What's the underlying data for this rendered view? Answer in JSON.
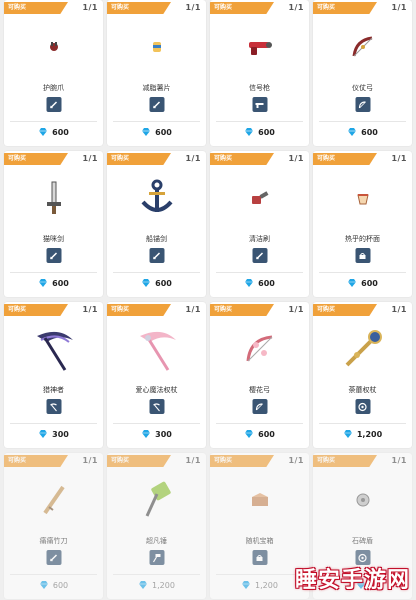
{
  "ribbon_label": "可购买",
  "colors": {
    "ribbon": "#f0a13a",
    "gem": "#1fa6e6",
    "type_icon_bg": "#3a5573"
  },
  "items": [
    {
      "name": "护腕爪",
      "count": "1/1",
      "price": "600",
      "type_icon": "sword-icon",
      "art": "claw-icon",
      "faded": false
    },
    {
      "name": "减脂薯片",
      "count": "1/1",
      "price": "600",
      "type_icon": "sword-icon",
      "art": "chips-icon",
      "faded": false
    },
    {
      "name": "信号枪",
      "count": "1/1",
      "price": "600",
      "type_icon": "gun-icon",
      "art": "flare-gun-icon",
      "faded": false
    },
    {
      "name": "仪仗弓",
      "count": "1/1",
      "price": "600",
      "type_icon": "bow-icon",
      "art": "bow-icon",
      "faded": false
    },
    {
      "name": "猫咪剑",
      "count": "1/1",
      "price": "600",
      "type_icon": "sword-icon",
      "art": "cat-sword-icon",
      "faded": false
    },
    {
      "name": "船锚剑",
      "count": "1/1",
      "price": "600",
      "type_icon": "sword-icon",
      "art": "anchor-icon",
      "faded": false
    },
    {
      "name": "清洁刷",
      "count": "1/1",
      "price": "600",
      "type_icon": "sword-icon",
      "art": "brush-icon",
      "faded": false
    },
    {
      "name": "热乎的杯面",
      "count": "1/1",
      "price": "600",
      "type_icon": "basket-icon",
      "art": "cup-noodle-icon",
      "faded": false
    },
    {
      "name": "猎神者",
      "count": "1/1",
      "price": "300",
      "type_icon": "scythe-icon",
      "art": "dark-scythe-icon",
      "faded": false
    },
    {
      "name": "爱心魔法权杖",
      "count": "1/1",
      "price": "300",
      "type_icon": "scythe-icon",
      "art": "pink-scythe-icon",
      "faded": false
    },
    {
      "name": "樱花弓",
      "count": "1/1",
      "price": "600",
      "type_icon": "bow-icon",
      "art": "sakura-bow-icon",
      "faded": false
    },
    {
      "name": "荼蘼权杖",
      "count": "1/1",
      "price": "1,200",
      "type_icon": "orb-icon",
      "art": "staff-icon",
      "faded": false
    },
    {
      "name": "痛痛竹刀",
      "count": "1/1",
      "price": "600",
      "type_icon": "sword-icon",
      "art": "bamboo-sword-icon",
      "faded": true
    },
    {
      "name": "超凡锤",
      "count": "1/1",
      "price": "1,200",
      "type_icon": "hammer-icon",
      "art": "hammer-icon",
      "faded": true
    },
    {
      "name": "随机宝箱",
      "count": "1/1",
      "price": "1,200",
      "type_icon": "basket-icon",
      "art": "treasure-box-icon",
      "faded": true
    },
    {
      "name": "石碑盾",
      "count": "1/1",
      "price": "",
      "type_icon": "orb-icon",
      "art": "stone-shield-icon",
      "faded": true
    }
  ],
  "watermark": "睡安手游网"
}
